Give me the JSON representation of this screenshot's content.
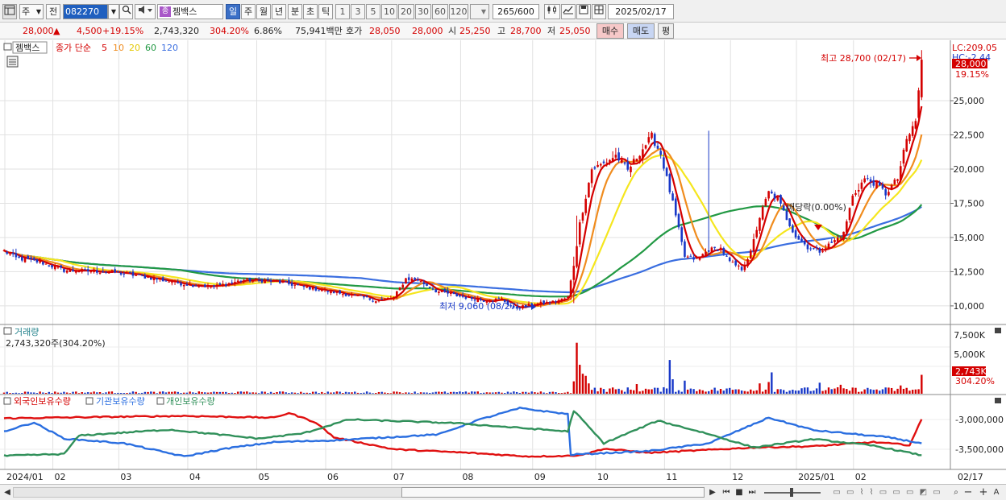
{
  "toolbar": {
    "type_label": "주",
    "prev_label": "전",
    "code": "082270",
    "name_tag": "종",
    "name": "젬백스",
    "periods": [
      "일",
      "주",
      "월",
      "년",
      "분",
      "초",
      "틱"
    ],
    "active_period": "일",
    "intervals": [
      "1",
      "3",
      "5",
      "10",
      "20",
      "30",
      "60",
      "120"
    ],
    "count": "265",
    "count_total": "/600",
    "date": "2025/02/17"
  },
  "quote": {
    "price": "28,000",
    "change_arrow": "▲",
    "change": "4,500",
    "change_pct": "+19.15%",
    "volume": "2,743,320",
    "volume_ratio": "304.20%",
    "turnover_pct": "6.86%",
    "amount": "75,941백만",
    "bid_label": "호가",
    "bid1": "28,050",
    "bid2": "28,000",
    "open_label": "시",
    "open": "25,250",
    "high_label": "고",
    "high": "28,700",
    "low_label": "저",
    "low": "25,050",
    "buy_label": "매수",
    "sell_label": "매도",
    "avg_label": "평"
  },
  "legend": {
    "stock": "젬백스",
    "ma_label": "종가 단순",
    "ma_periods": [
      "5",
      "10",
      "20",
      "60",
      "120"
    ],
    "lc": "LC:209.05",
    "hc": "HC:-2.44"
  },
  "annotations": {
    "high": "최고 28,700 (02/17)",
    "low": "최저 9,060 (08/27)",
    "dividend": "배당락(0.00%)",
    "last_price": "28,000",
    "last_pct": "19.15%"
  },
  "volume_panel": {
    "title": "거래량",
    "subtitle": "2,743,320주(304.20%)",
    "last_tag": "2,743K",
    "last_pct": "304.20%"
  },
  "holding_panel": {
    "legends": [
      "외국인보유수량",
      "기관보유수량",
      "개인보유수량"
    ]
  },
  "scroll": {
    "right_label": "02/17"
  },
  "colors": {
    "up": "#d40000",
    "down": "#1838c8",
    "ma5": "#d40000",
    "ma10": "#f08c1e",
    "ma20": "#f5e61e",
    "ma60": "#229944",
    "ma120": "#3a6ee0",
    "foreign": "#e01010",
    "institution": "#2a6ee0",
    "individual": "#30905a"
  },
  "chart_data": [
    {
      "type": "candlestick",
      "title": "젬백스",
      "x_labels": [
        "2024/01",
        "02",
        "03",
        "04",
        "05",
        "06",
        "07",
        "08",
        "09",
        "10",
        "11",
        "12",
        "2025/01",
        "02"
      ],
      "y_ticks": [
        10000,
        12500,
        15000,
        17500,
        20000,
        22500,
        25000
      ],
      "ylim": [
        8700,
        29300
      ],
      "anchors_close": [
        [
          0,
          14000
        ],
        [
          4,
          13500
        ],
        [
          12,
          13200
        ],
        [
          20,
          12600
        ],
        [
          35,
          12500
        ],
        [
          45,
          12200
        ],
        [
          60,
          11600
        ],
        [
          70,
          11400
        ],
        [
          80,
          11900
        ],
        [
          90,
          11800
        ],
        [
          100,
          11400
        ],
        [
          110,
          11000
        ],
        [
          118,
          10700
        ],
        [
          124,
          10400
        ],
        [
          130,
          10600
        ],
        [
          134,
          12000
        ],
        [
          138,
          11900
        ],
        [
          144,
          11100
        ],
        [
          152,
          10700
        ],
        [
          160,
          10400
        ],
        [
          166,
          10500
        ],
        [
          170,
          9800
        ],
        [
          176,
          10100
        ],
        [
          183,
          10300
        ],
        [
          188,
          10600
        ],
        [
          190,
          13000
        ],
        [
          192,
          16000
        ],
        [
          196,
          20000
        ],
        [
          200,
          20400
        ],
        [
          204,
          21000
        ],
        [
          208,
          19900
        ],
        [
          212,
          21200
        ],
        [
          216,
          22400
        ],
        [
          219,
          21100
        ],
        [
          223,
          17500
        ],
        [
          227,
          13600
        ],
        [
          231,
          13400
        ],
        [
          235,
          14100
        ],
        [
          239,
          14200
        ],
        [
          242,
          13200
        ],
        [
          246,
          12700
        ],
        [
          249,
          13900
        ],
        [
          252,
          16500
        ],
        [
          255,
          18300
        ],
        [
          258,
          17800
        ],
        [
          261,
          16400
        ],
        [
          264,
          15100
        ],
        [
          268,
          14300
        ],
        [
          272,
          14000
        ],
        [
          276,
          14600
        ],
        [
          280,
          15300
        ],
        [
          283,
          18000
        ],
        [
          287,
          19300
        ],
        [
          291,
          18900
        ],
        [
          294,
          18200
        ],
        [
          298,
          19300
        ],
        [
          301,
          22100
        ],
        [
          304,
          23500
        ],
        [
          306,
          28000
        ]
      ],
      "highlights": {
        "high": 28700,
        "high_date": "02/17",
        "low": 9060,
        "low_date": "08/27"
      }
    },
    {
      "type": "bar",
      "title": "거래량",
      "y_ticks": [
        "2,500K",
        "5,000K",
        "7,500K"
      ],
      "spikes": [
        [
          190,
          1800
        ],
        [
          191,
          7400
        ],
        [
          192,
          4200
        ],
        [
          193,
          2900
        ],
        [
          194,
          2600
        ],
        [
          195,
          1500
        ],
        [
          211,
          1400
        ],
        [
          222,
          4900
        ],
        [
          223,
          2100
        ],
        [
          227,
          1900
        ],
        [
          252,
          1500
        ],
        [
          255,
          1700
        ],
        [
          256,
          3100
        ],
        [
          272,
          1600
        ],
        [
          279,
          1300
        ],
        [
          299,
          1200
        ],
        [
          306,
          2743
        ]
      ]
    },
    {
      "type": "line",
      "title": "외국인보유수량 / 기관보유수량 / 개인보유수량",
      "y_ticks": [
        "-3,000,000",
        "-3,500,000"
      ],
      "series": [
        {
          "name": "외국인보유수량",
          "anchors": [
            [
              0,
              -2980000
            ],
            [
              30,
              -2960000
            ],
            [
              60,
              -2940000
            ],
            [
              90,
              -2970000
            ],
            [
              95,
              -2890000
            ],
            [
              104,
              -3050000
            ],
            [
              110,
              -3300000
            ],
            [
              130,
              -3500000
            ],
            [
              155,
              -3560000
            ],
            [
              175,
              -3620000
            ],
            [
              189,
              -3610000
            ],
            [
              194,
              -3580000
            ],
            [
              200,
              -3490000
            ],
            [
              215,
              -3560000
            ],
            [
              235,
              -3510000
            ],
            [
              250,
              -3470000
            ],
            [
              270,
              -3450000
            ],
            [
              290,
              -3380000
            ],
            [
              302,
              -3430000
            ],
            [
              306,
              -3000000
            ]
          ]
        },
        {
          "name": "기관보유수량",
          "anchors": [
            [
              0,
              -3200000
            ],
            [
              10,
              -3050000
            ],
            [
              20,
              -3320000
            ],
            [
              40,
              -3400000
            ],
            [
              60,
              -3620000
            ],
            [
              75,
              -3480000
            ],
            [
              90,
              -3380000
            ],
            [
              110,
              -3350000
            ],
            [
              145,
              -3250000
            ],
            [
              158,
              -3010000
            ],
            [
              172,
              -2810000
            ],
            [
              188,
              -2910000
            ],
            [
              189,
              -3590000
            ],
            [
              215,
              -3530000
            ],
            [
              235,
              -3400000
            ],
            [
              255,
              -2970000
            ],
            [
              270,
              -3180000
            ],
            [
              295,
              -3300000
            ],
            [
              306,
              -3400000
            ]
          ]
        },
        {
          "name": "개인보유수량",
          "anchors": [
            [
              0,
              -3610000
            ],
            [
              20,
              -3580000
            ],
            [
              25,
              -3270000
            ],
            [
              55,
              -3170000
            ],
            [
              85,
              -3320000
            ],
            [
              100,
              -3230000
            ],
            [
              115,
              -3000000
            ],
            [
              150,
              -3060000
            ],
            [
              188,
              -3200000
            ],
            [
              190,
              -2850000
            ],
            [
              200,
              -3400000
            ],
            [
              218,
              -3020000
            ],
            [
              234,
              -3230000
            ],
            [
              250,
              -3470000
            ],
            [
              270,
              -3330000
            ],
            [
              290,
              -3440000
            ],
            [
              306,
              -3600000
            ]
          ]
        }
      ]
    }
  ]
}
